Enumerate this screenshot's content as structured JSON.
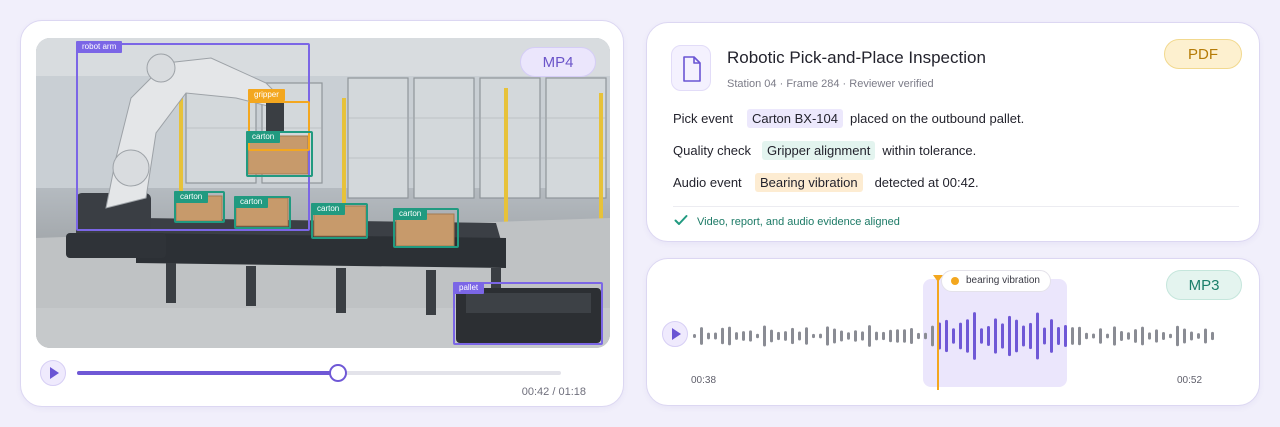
{
  "video": {
    "badge": "MP4",
    "time": "00:42 / 01:18",
    "progress": 0.54,
    "detections": {
      "robot_arm": "robot arm",
      "gripper": "gripper",
      "carton": "carton",
      "pallet": "pallet"
    }
  },
  "report": {
    "badge": "PDF",
    "title": "Robotic Pick-and-Place Inspection",
    "subtitle": "Station 04 · Frame 284 · Reviewer verified",
    "rows": [
      {
        "label": "Pick event",
        "chip": "Carton BX-104",
        "text": "placed on the outbound pallet."
      },
      {
        "label": "Quality check",
        "chip": "Gripper alignment",
        "text": "within tolerance."
      },
      {
        "label": "Audio event",
        "chip": "Bearing vibration",
        "text": "detected at 00:42."
      }
    ],
    "status": "Video, report, and audio evidence aligned"
  },
  "audio": {
    "badge": "MP3",
    "event": "bearing vibration",
    "start_time": "00:38",
    "end_time": "00:52"
  },
  "colors": {
    "accent_purple": "#6f58d6",
    "accent_orange": "#f3a71f",
    "accent_teal": "#219a80"
  }
}
